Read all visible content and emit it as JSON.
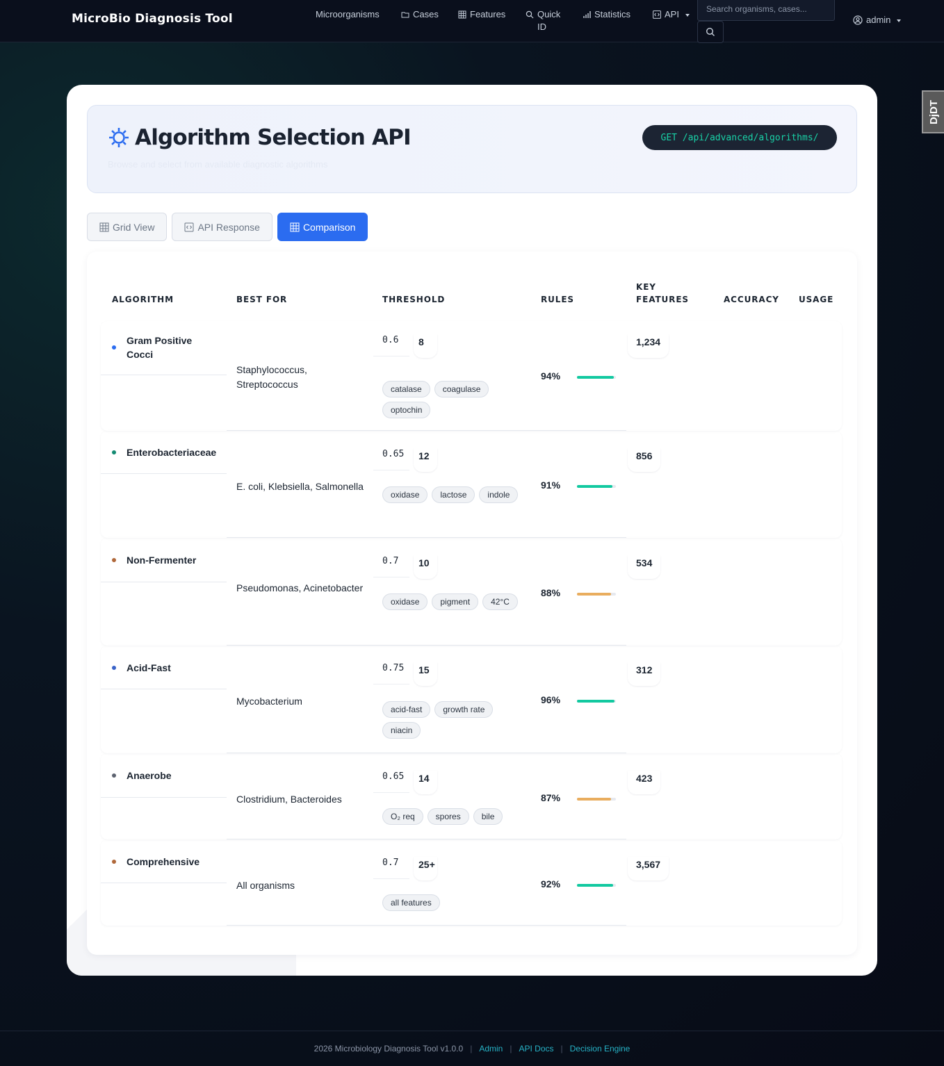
{
  "navbar": {
    "brand": "MicroBio Diagnosis Tool",
    "items": [
      {
        "label": "Microorganisms"
      },
      {
        "label": "Cases"
      },
      {
        "label": "Features"
      },
      {
        "label": "Quick ID"
      },
      {
        "label": "Statistics"
      },
      {
        "label": "API"
      }
    ],
    "search_placeholder": "Search organisms, cases...",
    "user": "admin"
  },
  "debug_toolbar": "DjDT",
  "hero": {
    "title": "Algorithm Selection API",
    "subtitle": "Browse and select from available diagnostic algorithms",
    "endpoint": "GET /api/advanced/algorithms/"
  },
  "tabs": [
    {
      "label": "Grid View",
      "active": false
    },
    {
      "label": "API Response",
      "active": false
    },
    {
      "label": "Comparison",
      "active": true
    }
  ],
  "table": {
    "headers": {
      "algorithm": "ALGORITHM",
      "best_for": "BEST FOR",
      "threshold": "THRESHOLD",
      "rules": "RULES",
      "key_features": "KEY FEATURES",
      "accuracy": "ACCURACY",
      "usage": "USAGE"
    },
    "rows": [
      {
        "name": "Gram Positive Cocci",
        "dot_color": "#2b6cf0",
        "best_for": "Staphylococcus, Streptococcus",
        "threshold": "0.6",
        "rules": "8",
        "features": [
          "catalase",
          "coagulase",
          "optochin"
        ],
        "accuracy": "94%",
        "accuracy_value": 0.94,
        "bar_color": "#12c9a0",
        "usage": "1,234"
      },
      {
        "name": "Enterobacteriaceae",
        "dot_color": "#138a72",
        "best_for": "E. coli, Klebsiella, Salmonella",
        "threshold": "0.65",
        "rules": "12",
        "features": [
          "oxidase",
          "lactose",
          "indole"
        ],
        "accuracy": "91%",
        "accuracy_value": 0.91,
        "bar_color": "#12c9a0",
        "usage": "856"
      },
      {
        "name": "Non-Fermenter",
        "dot_color": "#b0683a",
        "best_for": "Pseudomonas, Acinetobacter",
        "threshold": "0.7",
        "rules": "10",
        "features": [
          "oxidase",
          "pigment",
          "42°C"
        ],
        "accuracy": "88%",
        "accuracy_value": 0.88,
        "bar_color": "#e9ad5e",
        "usage": "534"
      },
      {
        "name": "Acid-Fast",
        "dot_color": "#3a63c8",
        "best_for": "Mycobacterium",
        "threshold": "0.75",
        "rules": "15",
        "features": [
          "acid-fast",
          "growth rate",
          "niacin"
        ],
        "accuracy": "96%",
        "accuracy_value": 0.96,
        "bar_color": "#12c9a0",
        "usage": "312"
      },
      {
        "name": "Anaerobe",
        "dot_color": "#5d6370",
        "best_for": "Clostridium, Bacteroides",
        "threshold": "0.65",
        "rules": "14",
        "features": [
          "O₂ req",
          "spores",
          "bile"
        ],
        "accuracy": "87%",
        "accuracy_value": 0.87,
        "bar_color": "#e9ad5e",
        "usage": "423"
      },
      {
        "name": "Comprehensive",
        "dot_color": "#b0683a",
        "best_for": "All organisms",
        "threshold": "0.7",
        "rules": "25+",
        "features": [
          "all features"
        ],
        "accuracy": "92%",
        "accuracy_value": 0.92,
        "bar_color": "#12c9a0",
        "usage": "3,567"
      }
    ]
  },
  "footer": {
    "copyright": "2026 Microbiology Diagnosis Tool v1.0.0",
    "links": [
      "Admin",
      "API Docs",
      "Decision Engine"
    ]
  }
}
